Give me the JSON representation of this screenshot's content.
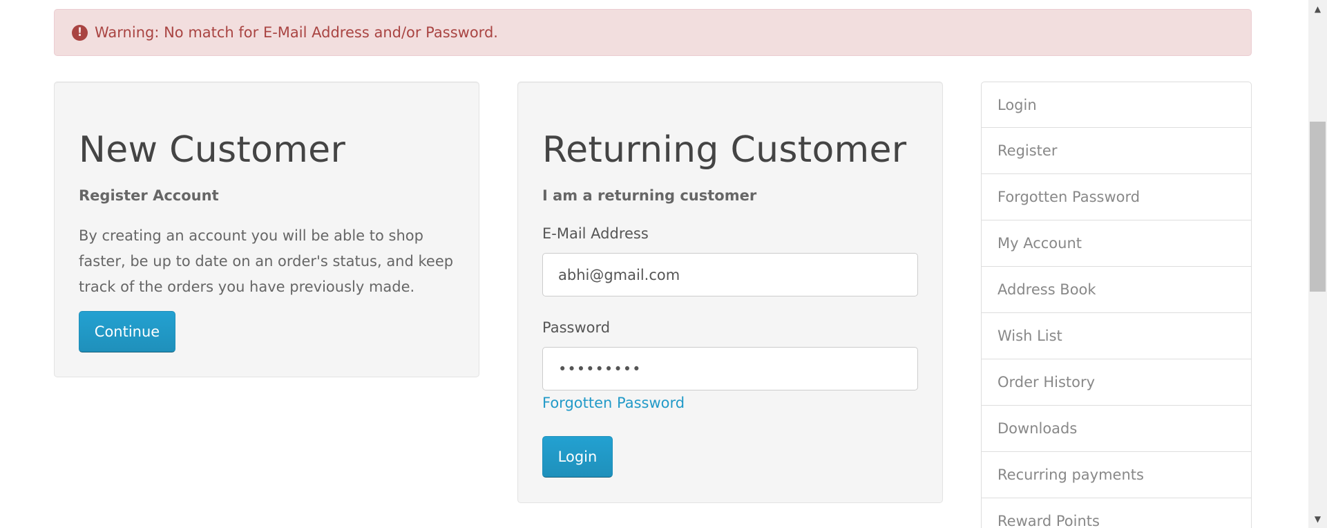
{
  "alert": {
    "icon": "exclamation-circle-icon",
    "text": "Warning: No match for E-Mail Address and/or Password."
  },
  "new_customer": {
    "title": "New Customer",
    "subtitle": "Register Account",
    "description": "By creating an account you will be able to shop faster, be up to date on an order's status, and keep track of the orders you have previously made.",
    "continue_label": "Continue"
  },
  "returning_customer": {
    "title": "Returning Customer",
    "subtitle": "I am a returning customer",
    "email_label": "E-Mail Address",
    "email_value": "abhi@gmail.com",
    "password_label": "Password",
    "password_value": "•••••••••",
    "forgot_label": "Forgotten Password",
    "login_label": "Login"
  },
  "sidebar": {
    "items": [
      {
        "label": "Login"
      },
      {
        "label": "Register"
      },
      {
        "label": "Forgotten Password"
      },
      {
        "label": "My Account"
      },
      {
        "label": "Address Book"
      },
      {
        "label": "Wish List"
      },
      {
        "label": "Order History"
      },
      {
        "label": "Downloads"
      },
      {
        "label": "Recurring payments"
      },
      {
        "label": "Reward Points"
      }
    ]
  },
  "scrollbar": {
    "up_icon": "scroll-up-arrow-icon",
    "down_icon": "scroll-down-arrow-icon"
  }
}
